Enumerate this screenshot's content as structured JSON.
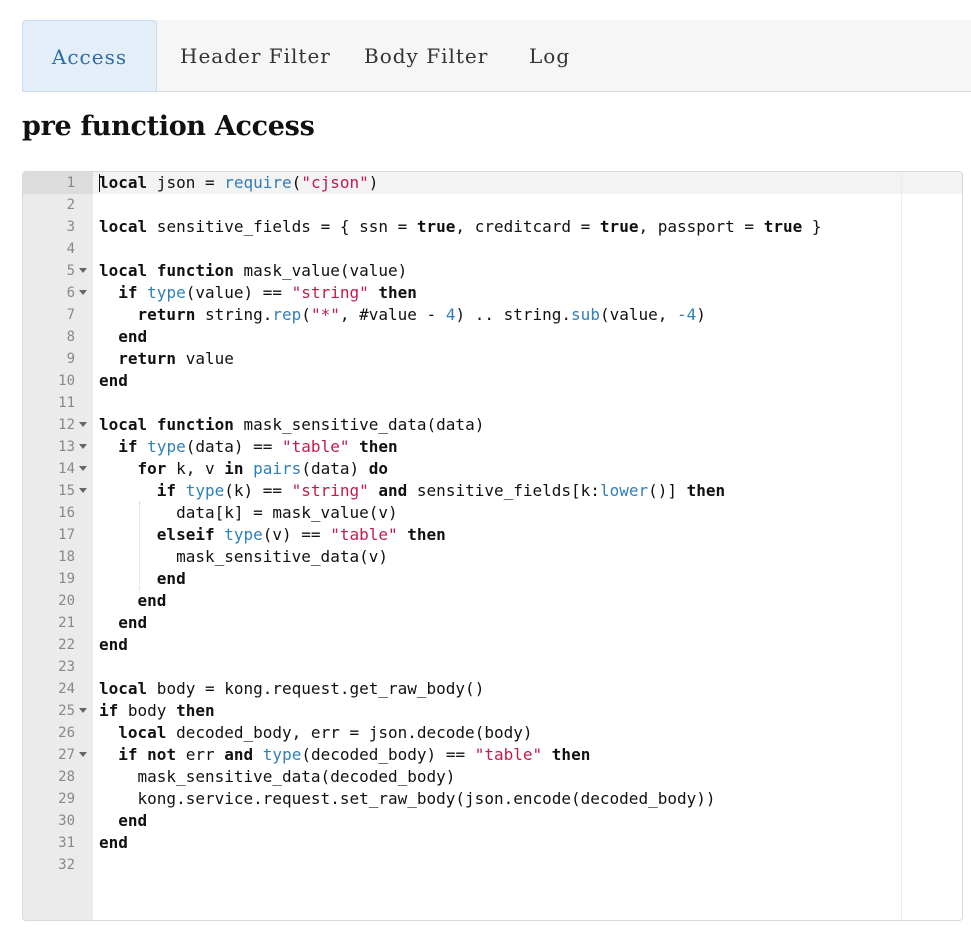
{
  "tabs": [
    {
      "label": "Access",
      "active": true
    },
    {
      "label": "Header Filter",
      "active": false
    },
    {
      "label": "Body Filter",
      "active": false
    },
    {
      "label": "Log",
      "active": false
    }
  ],
  "heading": "pre function Access",
  "editor": {
    "active_line": 1,
    "lines": [
      {
        "n": "1",
        "fold": false,
        "tokens": [
          [
            "kw",
            "local"
          ],
          [
            "t",
            " json = "
          ],
          [
            "fn",
            "require"
          ],
          [
            "t",
            "("
          ],
          [
            "str",
            "\"cjson\""
          ],
          [
            "t",
            ")"
          ]
        ]
      },
      {
        "n": "2",
        "fold": false,
        "tokens": []
      },
      {
        "n": "3",
        "fold": false,
        "tokens": [
          [
            "kw",
            "local"
          ],
          [
            "t",
            " sensitive_fields = { ssn = "
          ],
          [
            "kw",
            "true"
          ],
          [
            "t",
            ", creditcard = "
          ],
          [
            "kw",
            "true"
          ],
          [
            "t",
            ", passport = "
          ],
          [
            "kw",
            "true"
          ],
          [
            "t",
            " }"
          ]
        ]
      },
      {
        "n": "4",
        "fold": false,
        "tokens": []
      },
      {
        "n": "5",
        "fold": true,
        "tokens": [
          [
            "kw",
            "local"
          ],
          [
            "t",
            " "
          ],
          [
            "kw",
            "function"
          ],
          [
            "t",
            " mask_value(value)"
          ]
        ]
      },
      {
        "n": "6",
        "fold": true,
        "tokens": [
          [
            "t",
            "  "
          ],
          [
            "kw",
            "if"
          ],
          [
            "t",
            " "
          ],
          [
            "fn",
            "type"
          ],
          [
            "t",
            "(value) == "
          ],
          [
            "str",
            "\"string\""
          ],
          [
            "t",
            " "
          ],
          [
            "kw",
            "then"
          ]
        ]
      },
      {
        "n": "7",
        "fold": false,
        "tokens": [
          [
            "t",
            "    "
          ],
          [
            "kw",
            "return"
          ],
          [
            "t",
            " string."
          ],
          [
            "fn",
            "rep"
          ],
          [
            "t",
            "("
          ],
          [
            "str",
            "\"*\""
          ],
          [
            "t",
            ", #value - "
          ],
          [
            "num",
            "4"
          ],
          [
            "t",
            ") .. string."
          ],
          [
            "fn",
            "sub"
          ],
          [
            "t",
            "(value, "
          ],
          [
            "num",
            "-4"
          ],
          [
            "t",
            ")"
          ]
        ]
      },
      {
        "n": "8",
        "fold": false,
        "tokens": [
          [
            "t",
            "  "
          ],
          [
            "kw",
            "end"
          ]
        ]
      },
      {
        "n": "9",
        "fold": false,
        "tokens": [
          [
            "t",
            "  "
          ],
          [
            "kw",
            "return"
          ],
          [
            "t",
            " value"
          ]
        ]
      },
      {
        "n": "10",
        "fold": false,
        "tokens": [
          [
            "kw",
            "end"
          ]
        ]
      },
      {
        "n": "11",
        "fold": false,
        "tokens": []
      },
      {
        "n": "12",
        "fold": true,
        "tokens": [
          [
            "kw",
            "local"
          ],
          [
            "t",
            " "
          ],
          [
            "kw",
            "function"
          ],
          [
            "t",
            " mask_sensitive_data(data)"
          ]
        ]
      },
      {
        "n": "13",
        "fold": true,
        "tokens": [
          [
            "t",
            "  "
          ],
          [
            "kw",
            "if"
          ],
          [
            "t",
            " "
          ],
          [
            "fn",
            "type"
          ],
          [
            "t",
            "(data) == "
          ],
          [
            "str",
            "\"table\""
          ],
          [
            "t",
            " "
          ],
          [
            "kw",
            "then"
          ]
        ]
      },
      {
        "n": "14",
        "fold": true,
        "tokens": [
          [
            "t",
            "    "
          ],
          [
            "kw",
            "for"
          ],
          [
            "t",
            " k, v "
          ],
          [
            "kw",
            "in"
          ],
          [
            "t",
            " "
          ],
          [
            "fn",
            "pairs"
          ],
          [
            "t",
            "(data) "
          ],
          [
            "kw",
            "do"
          ]
        ]
      },
      {
        "n": "15",
        "fold": true,
        "tokens": [
          [
            "t",
            "      "
          ],
          [
            "kw",
            "if"
          ],
          [
            "t",
            " "
          ],
          [
            "fn",
            "type"
          ],
          [
            "t",
            "(k) == "
          ],
          [
            "str",
            "\"string\""
          ],
          [
            "t",
            " "
          ],
          [
            "kw",
            "and"
          ],
          [
            "t",
            " sensitive_fields[k:"
          ],
          [
            "fn",
            "lower"
          ],
          [
            "t",
            "()] "
          ],
          [
            "kw",
            "then"
          ]
        ]
      },
      {
        "n": "16",
        "fold": false,
        "tokens": [
          [
            "t",
            "        data[k] = mask_value(v)"
          ]
        ]
      },
      {
        "n": "17",
        "fold": false,
        "tokens": [
          [
            "t",
            "      "
          ],
          [
            "kw",
            "elseif"
          ],
          [
            "t",
            " "
          ],
          [
            "fn",
            "type"
          ],
          [
            "t",
            "(v) == "
          ],
          [
            "str",
            "\"table\""
          ],
          [
            "t",
            " "
          ],
          [
            "kw",
            "then"
          ]
        ]
      },
      {
        "n": "18",
        "fold": false,
        "tokens": [
          [
            "t",
            "        mask_sensitive_data(v)"
          ]
        ]
      },
      {
        "n": "19",
        "fold": false,
        "tokens": [
          [
            "t",
            "      "
          ],
          [
            "kw",
            "end"
          ]
        ]
      },
      {
        "n": "20",
        "fold": false,
        "tokens": [
          [
            "t",
            "    "
          ],
          [
            "kw",
            "end"
          ]
        ]
      },
      {
        "n": "21",
        "fold": false,
        "tokens": [
          [
            "t",
            "  "
          ],
          [
            "kw",
            "end"
          ]
        ]
      },
      {
        "n": "22",
        "fold": false,
        "tokens": [
          [
            "kw",
            "end"
          ]
        ]
      },
      {
        "n": "23",
        "fold": false,
        "tokens": []
      },
      {
        "n": "24",
        "fold": false,
        "tokens": [
          [
            "kw",
            "local"
          ],
          [
            "t",
            " body = kong.request.get_raw_body()"
          ]
        ]
      },
      {
        "n": "25",
        "fold": true,
        "tokens": [
          [
            "kw",
            "if"
          ],
          [
            "t",
            " body "
          ],
          [
            "kw",
            "then"
          ]
        ]
      },
      {
        "n": "26",
        "fold": false,
        "tokens": [
          [
            "t",
            "  "
          ],
          [
            "kw",
            "local"
          ],
          [
            "t",
            " decoded_body, err = json.decode(body)"
          ]
        ]
      },
      {
        "n": "27",
        "fold": true,
        "tokens": [
          [
            "t",
            "  "
          ],
          [
            "kw",
            "if"
          ],
          [
            "t",
            " "
          ],
          [
            "kw",
            "not"
          ],
          [
            "t",
            " err "
          ],
          [
            "kw",
            "and"
          ],
          [
            "t",
            " "
          ],
          [
            "fn",
            "type"
          ],
          [
            "t",
            "(decoded_body) == "
          ],
          [
            "str",
            "\"table\""
          ],
          [
            "t",
            " "
          ],
          [
            "kw",
            "then"
          ]
        ]
      },
      {
        "n": "28",
        "fold": false,
        "tokens": [
          [
            "t",
            "    mask_sensitive_data(decoded_body)"
          ]
        ]
      },
      {
        "n": "29",
        "fold": false,
        "tokens": [
          [
            "t",
            "    kong.service.request.set_raw_body(json.encode(decoded_body))"
          ]
        ]
      },
      {
        "n": "30",
        "fold": false,
        "tokens": [
          [
            "t",
            "  "
          ],
          [
            "kw",
            "end"
          ]
        ]
      },
      {
        "n": "31",
        "fold": false,
        "tokens": [
          [
            "kw",
            "end"
          ]
        ]
      },
      {
        "n": "32",
        "fold": false,
        "tokens": []
      }
    ]
  }
}
